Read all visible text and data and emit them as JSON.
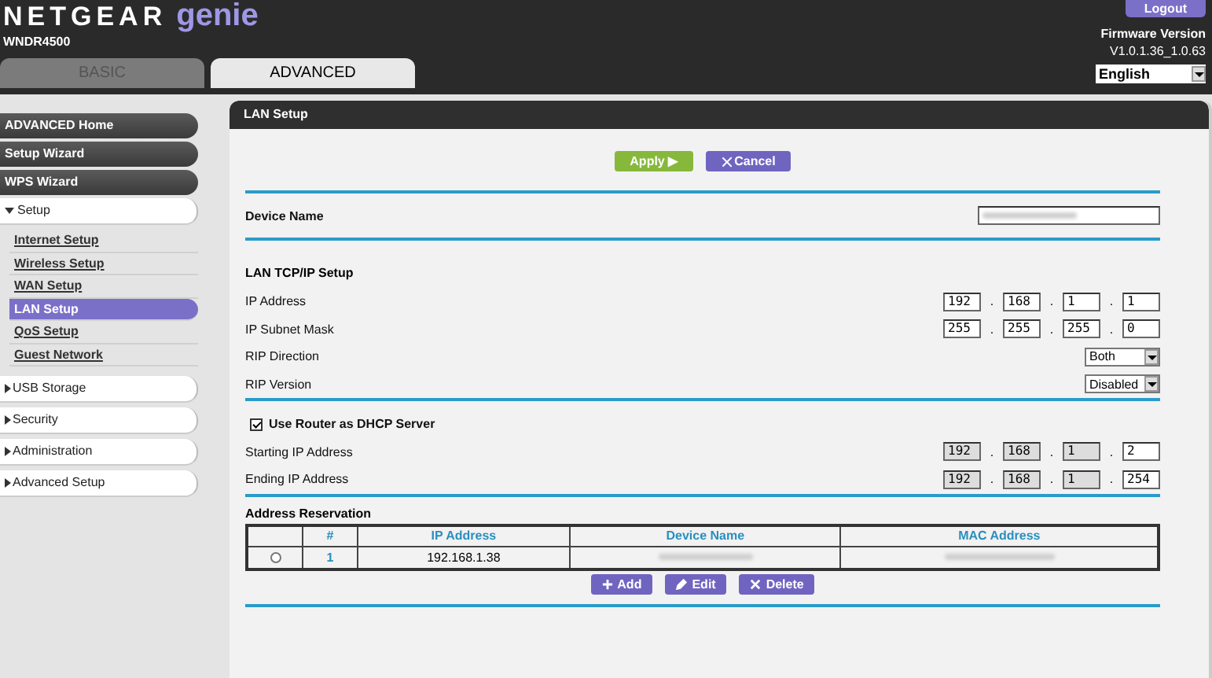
{
  "header": {
    "brand": "NETGEAR",
    "product": "genie",
    "model": "WNDR4500",
    "logout": "Logout",
    "firmware_label": "Firmware Version",
    "firmware_version": "V1.0.1.36_1.0.63",
    "language": "English"
  },
  "tabs": [
    {
      "label": "BASIC",
      "selected": false
    },
    {
      "label": "ADVANCED",
      "selected": true
    }
  ],
  "sidebar": {
    "items": [
      {
        "kind": "button",
        "label": "ADVANCED Home"
      },
      {
        "kind": "button",
        "label": "Setup Wizard"
      },
      {
        "kind": "button",
        "label": "WPS Wizard"
      },
      {
        "kind": "section",
        "label": "Setup",
        "expanded": true,
        "children": [
          {
            "label": "Internet Setup",
            "selected": false
          },
          {
            "label": "Wireless Setup",
            "selected": false
          },
          {
            "label": "WAN Setup",
            "selected": false
          },
          {
            "label": "LAN Setup",
            "selected": true
          },
          {
            "label": "QoS Setup",
            "selected": false
          },
          {
            "label": "Guest Network",
            "selected": false
          }
        ]
      },
      {
        "kind": "section",
        "label": "USB Storage",
        "expanded": false
      },
      {
        "kind": "section",
        "label": "Security",
        "expanded": false
      },
      {
        "kind": "section",
        "label": "Administration",
        "expanded": false
      },
      {
        "kind": "section",
        "label": "Advanced Setup",
        "expanded": false
      }
    ]
  },
  "panel": {
    "separator": ".",
    "title": "LAN Setup",
    "apply": "Apply ▶",
    "cancel": "Cancel",
    "device_name": {
      "label": "Device Name"
    },
    "tcpip": {
      "title": "LAN TCP/IP Setup",
      "rows": [
        {
          "kind": "ip",
          "label": "IP Address",
          "octets": [
            {
              "value": "192",
              "disabled": false
            },
            {
              "value": "168",
              "disabled": false
            },
            {
              "value": "1",
              "disabled": false
            },
            {
              "value": "1",
              "disabled": false
            }
          ]
        },
        {
          "kind": "ip",
          "label": "IP Subnet Mask",
          "octets": [
            {
              "value": "255",
              "disabled": false
            },
            {
              "value": "255",
              "disabled": false
            },
            {
              "value": "255",
              "disabled": false
            },
            {
              "value": "0",
              "disabled": false
            }
          ]
        },
        {
          "kind": "select",
          "label": "RIP Direction",
          "value": "Both"
        },
        {
          "kind": "select",
          "label": "RIP Version",
          "value": "Disabled"
        }
      ]
    },
    "dhcp": {
      "label": "Use Router as DHCP Server",
      "checked": true,
      "rows": [
        {
          "kind": "ip",
          "label": "Starting IP Address",
          "octets": [
            {
              "value": "192",
              "disabled": true
            },
            {
              "value": "168",
              "disabled": true
            },
            {
              "value": "1",
              "disabled": true
            },
            {
              "value": "2",
              "disabled": false
            }
          ]
        },
        {
          "kind": "ip",
          "label": "Ending IP Address",
          "octets": [
            {
              "value": "192",
              "disabled": true
            },
            {
              "value": "168",
              "disabled": true
            },
            {
              "value": "1",
              "disabled": true
            },
            {
              "value": "254",
              "disabled": false
            }
          ]
        }
      ]
    },
    "reservation": {
      "title": "Address Reservation",
      "columns": [
        "#",
        "IP Address",
        "Device Name",
        "MAC Address"
      ],
      "rows": [
        {
          "selected": false,
          "number": "1",
          "ip": "192.168.1.38"
        }
      ],
      "buttons": [
        "Add",
        "Edit",
        "Delete"
      ]
    }
  }
}
